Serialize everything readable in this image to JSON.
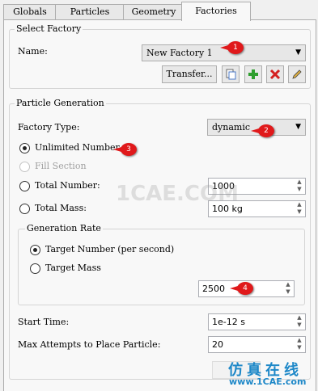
{
  "tabs": [
    "Globals",
    "Particles",
    "Geometry",
    "Factories"
  ],
  "select_factory": {
    "title": "Select Factory",
    "name_label": "Name:",
    "name_value": "New Factory 1",
    "transfer_label": "Transfer..."
  },
  "generation": {
    "title": "Particle Generation",
    "factory_type_label": "Factory Type:",
    "factory_type_value": "dynamic",
    "unlimited_label": "Unlimited Number",
    "fill_label": "Fill Section",
    "total_number_label": "Total Number:",
    "total_number_value": "1000",
    "total_mass_label": "Total Mass:",
    "total_mass_value": "100 kg",
    "rate": {
      "title": "Generation Rate",
      "target_number_label": "Target Number (per second)",
      "target_mass_label": "Target Mass",
      "rate_value": "2500"
    },
    "start_time_label": "Start Time:",
    "start_time_value": "1e-12 s",
    "max_attempts_label": "Max Attempts to Place Particle:",
    "max_attempts_value": "20"
  },
  "callouts": [
    "1",
    "2",
    "3",
    "4"
  ],
  "watermark": "1CAE.COM",
  "brand": {
    "cn": "仿真在线",
    "url": "www.1CAE.com"
  }
}
